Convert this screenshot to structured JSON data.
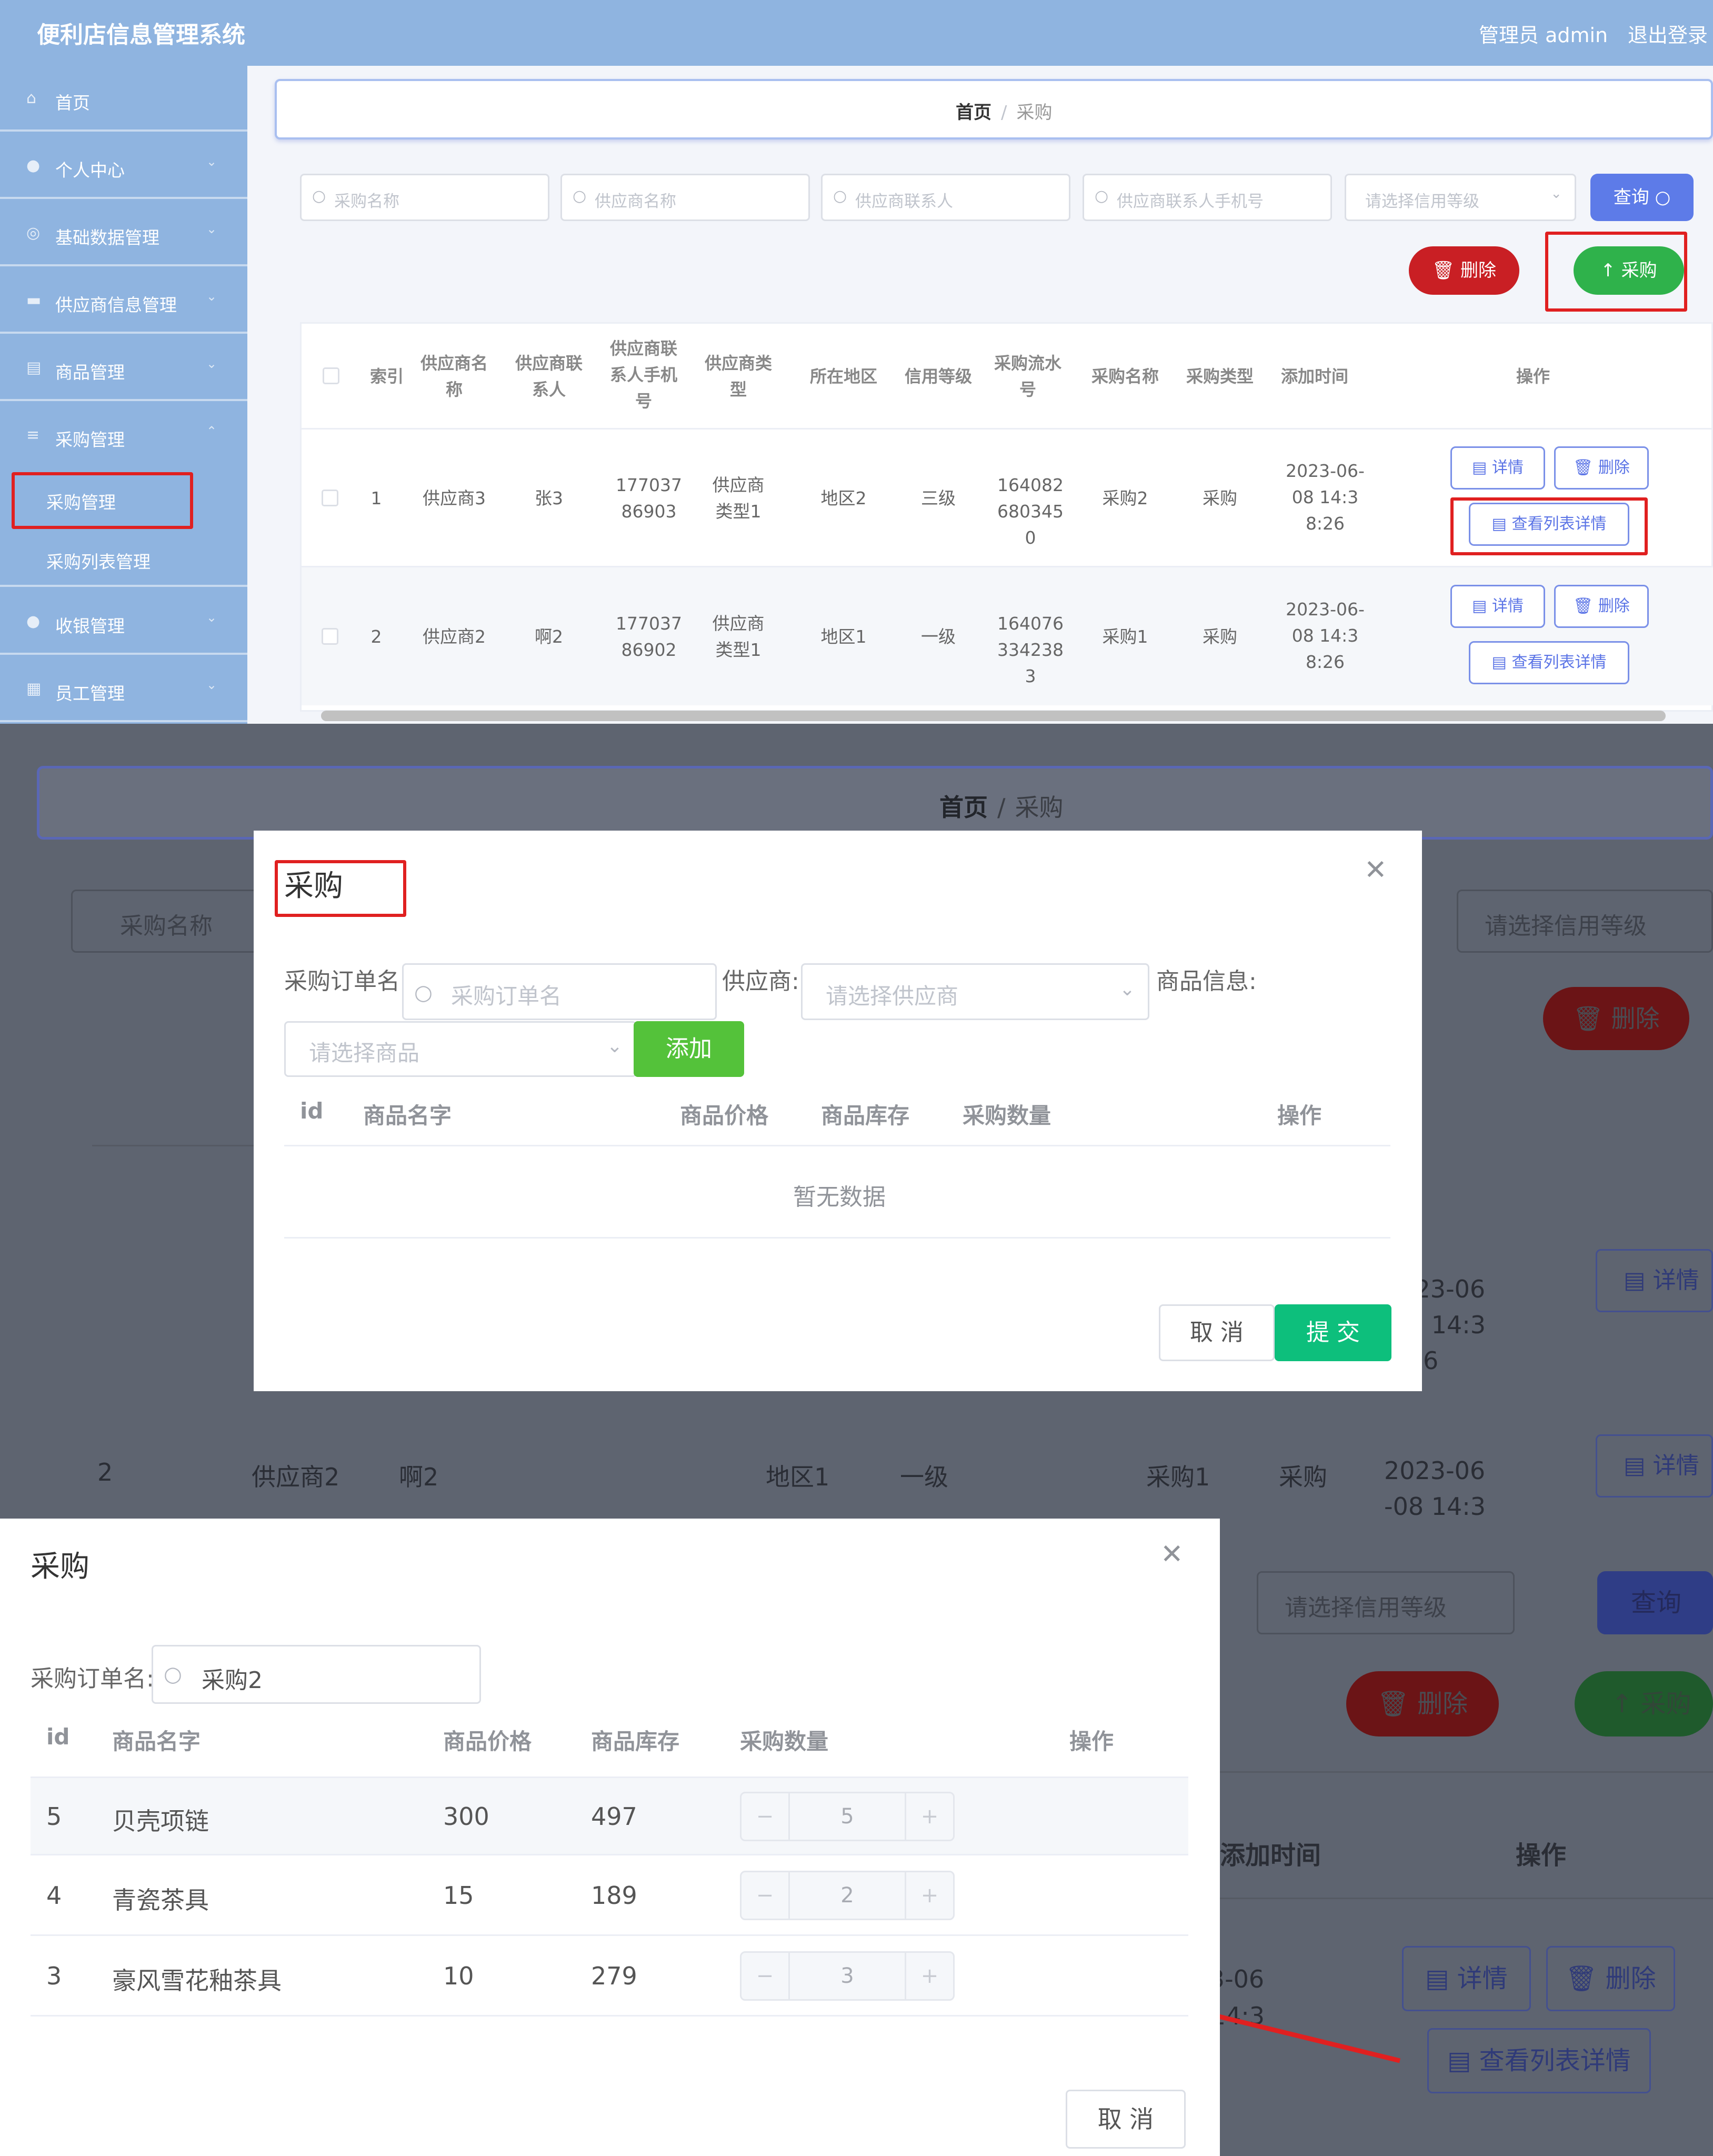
{
  "app": {
    "title": "便利店信息管理系统",
    "admin": "管理员 admin",
    "logout": "退出登录"
  },
  "sidebar": {
    "home": "首页",
    "personal": "个人中心",
    "basic": "基础数据管理",
    "supplier": "供应商信息管理",
    "goods": "商品管理",
    "purchase": "采购管理",
    "sub_purchase": "采购管理",
    "sub_list": "采购列表管理",
    "receipt": "收银管理",
    "staff": "员工管理"
  },
  "breadcrumb": {
    "home": "首页",
    "sep": "/",
    "current": "采购"
  },
  "search": {
    "purchase_name": "采购名称",
    "supplier_name": "供应商名称",
    "supplier_contact": "供应商联系人",
    "supplier_phone": "供应商联系人手机号",
    "credit_level": "请选择信用等级",
    "query": "查询"
  },
  "actions": {
    "delete": "删除",
    "purchase": "采购"
  },
  "table": {
    "headers": [
      "索引",
      "供应商名称",
      "供应商联系人",
      "供应商联系人手机号",
      "供应商类型",
      "所在地区",
      "信用等级",
      "采购流水号",
      "采购名称",
      "采购类型",
      "添加时间",
      "操作"
    ],
    "rows": [
      {
        "index": "1",
        "supplier": "供应商3",
        "contact": "张3",
        "phone": "17703786903",
        "type": "供应商类型1",
        "region": "地区2",
        "credit": "三级",
        "serial": "1640826803450",
        "name": "采购2",
        "ptype": "采购",
        "time": "2023-06-08 14:38:26"
      },
      {
        "index": "2",
        "supplier": "供应商2",
        "contact": "啊2",
        "phone": "17703786902",
        "type": "供应商类型1",
        "region": "地区1",
        "credit": "一级",
        "serial": "1640763342383",
        "name": "采购1",
        "ptype": "采购",
        "time": "2023-06-08 14:38:26"
      }
    ],
    "ops": {
      "detail": "详情",
      "delete": "删除",
      "list_detail": "查看列表详情"
    }
  },
  "modal1": {
    "title": "采购",
    "order_label": "采购订单名:",
    "order_placeholder": "采购订单名",
    "supplier_label": "供应商:",
    "supplier_placeholder": "请选择供应商",
    "goods_label": "商品信息:",
    "goods_placeholder": "请选择商品",
    "add": "添加",
    "headers": [
      "id",
      "商品名字",
      "商品价格",
      "商品库存",
      "采购数量",
      "操作"
    ],
    "empty": "暂无数据",
    "cancel": "取 消",
    "submit": "提 交"
  },
  "modal2": {
    "title": "采购",
    "order_label": "采购订单名:",
    "order_value": "采购2",
    "headers": [
      "id",
      "商品名字",
      "商品价格",
      "商品库存",
      "采购数量",
      "操作"
    ],
    "rows": [
      {
        "id": "5",
        "name": "贝壳项链",
        "price": "300",
        "stock": "497",
        "qty": "5"
      },
      {
        "id": "4",
        "name": "青瓷茶具",
        "price": "15",
        "stock": "189",
        "qty": "2"
      },
      {
        "id": "3",
        "name": "豪风雪花釉茶具",
        "price": "10",
        "stock": "279",
        "qty": "3"
      }
    ],
    "cancel": "取 消"
  },
  "colors": {
    "sidebar": "#8fb4e0",
    "danger": "#c91f24",
    "success": "#2fb24b",
    "primary": "#5d7be8",
    "submit": "#0dbf7c",
    "highlight": "#e02020"
  }
}
